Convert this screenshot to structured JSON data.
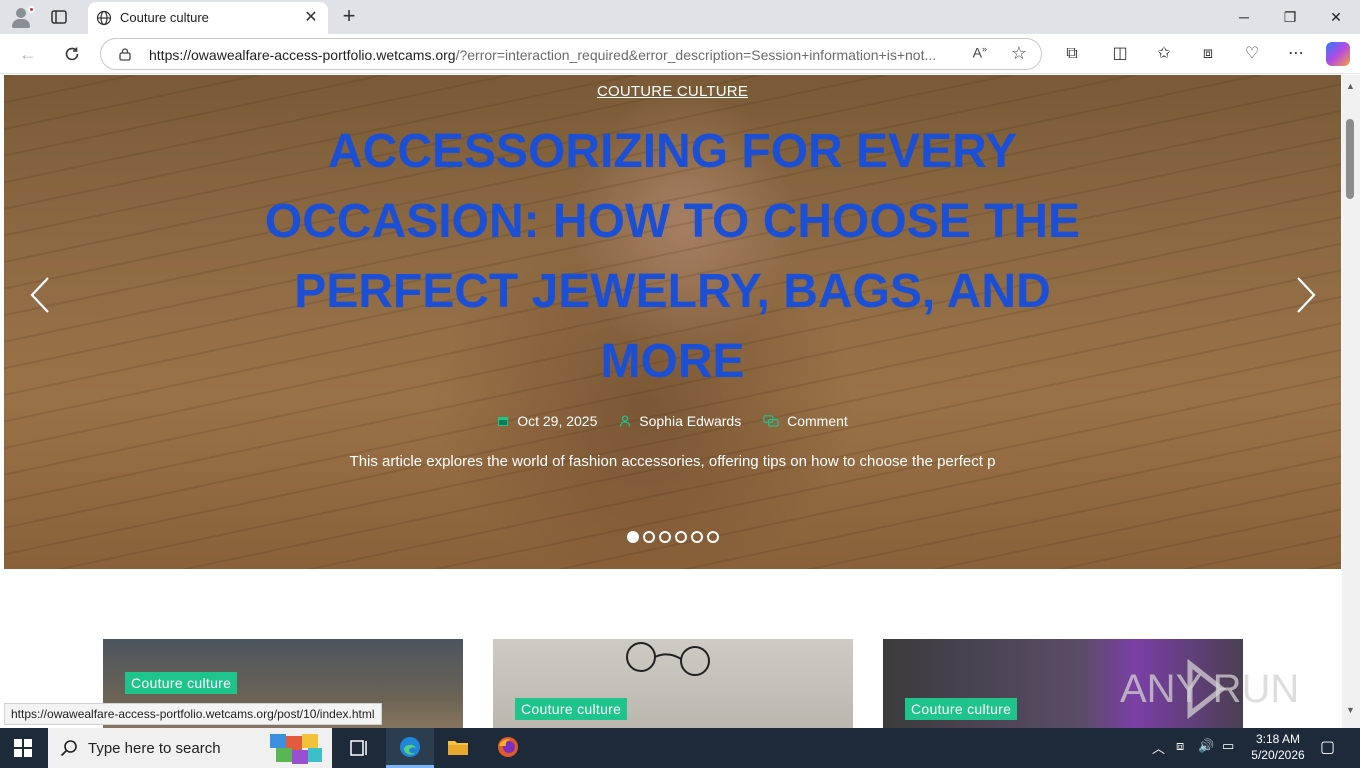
{
  "browser": {
    "tab_title": "Couture culture",
    "url_host": "https://owawealfare-access-portfolio.wetcams.org",
    "url_rest": "/?error=interaction_required&error_description=Session+information+is+not..."
  },
  "hero": {
    "category": "COUTURE CULTURE",
    "title": "ACCESSORIZING FOR EVERY OCCASION: HOW TO CHOOSE THE PERFECT JEWELRY, BAGS, AND MORE",
    "date": "Oct 29, 2025",
    "author": "Sophia Edwards",
    "comment": "Comment",
    "excerpt": "This article explores the world of fashion accessories, offering tips on how to choose the perfect p",
    "slide_count": 6,
    "active_slide": 1
  },
  "cards": [
    {
      "badge": "Couture culture"
    },
    {
      "badge": "Couture culture"
    },
    {
      "badge": "Couture culture"
    }
  ],
  "status_url": "https://owawealfare-access-portfolio.wetcams.org/post/10/index.html",
  "watermark": {
    "text": "ANY RUN"
  },
  "taskbar": {
    "search_placeholder": "Type here to search",
    "time": "3:18 AM",
    "date": "5/20/2026"
  },
  "colors": {
    "title_blue": "#1a4fd6",
    "accent_green": "#1ec48c",
    "taskbar": "#1c2a3a"
  }
}
